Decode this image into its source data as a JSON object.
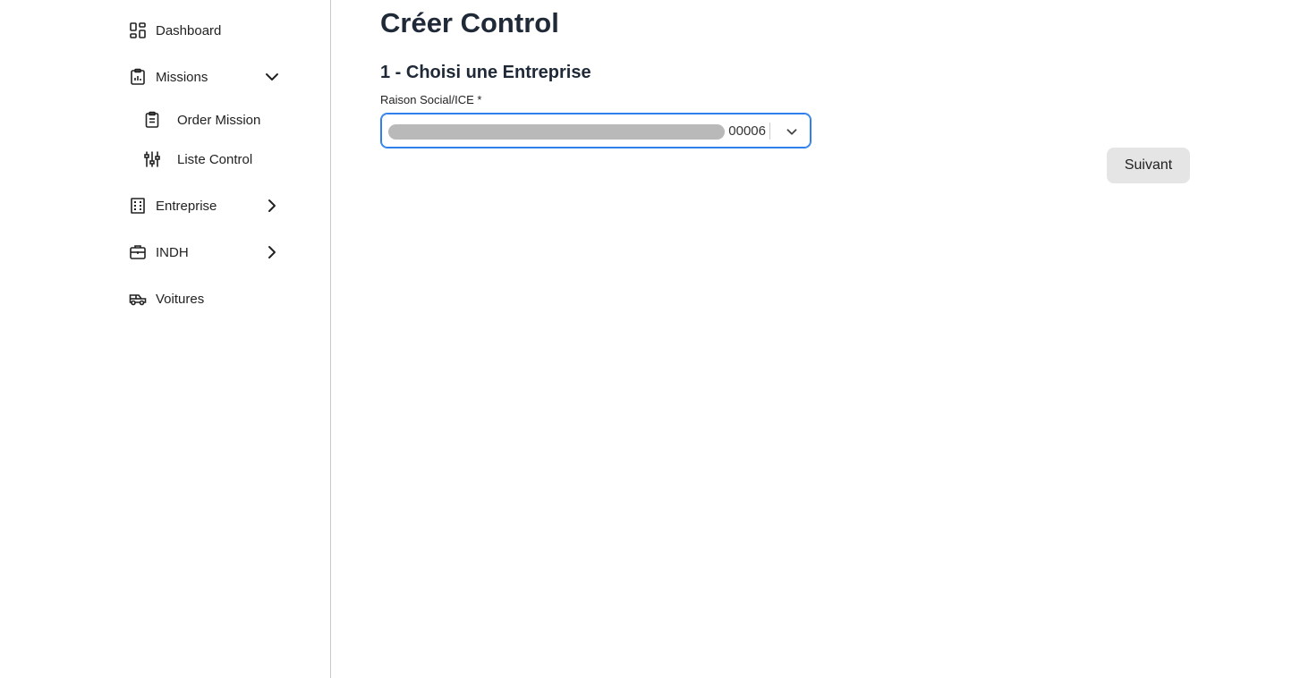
{
  "sidebar": {
    "items": [
      {
        "label": "Dashboard",
        "icon": "dashboard-icon"
      },
      {
        "label": "Missions",
        "icon": "clipboard-list-icon",
        "expanded": true,
        "children": [
          {
            "label": "Order Mission",
            "icon": "clipboard-icon"
          },
          {
            "label": "Liste Control",
            "icon": "sliders-icon"
          }
        ]
      },
      {
        "label": "Entreprise",
        "icon": "building-icon",
        "expanded": false
      },
      {
        "label": "INDH",
        "icon": "briefcase-icon",
        "expanded": false
      },
      {
        "label": "Voitures",
        "icon": "car-icon"
      }
    ]
  },
  "main": {
    "title": "Créer Control",
    "step_title": "1 - Choisi une Entreprise",
    "field_label": "Raison Social/ICE *",
    "select_value_visible": "00006",
    "next_label": "Suivant"
  },
  "colors": {
    "focus_border": "#2f80ed",
    "button_bg": "#e5e5e5",
    "text_dark": "#1f2937"
  }
}
